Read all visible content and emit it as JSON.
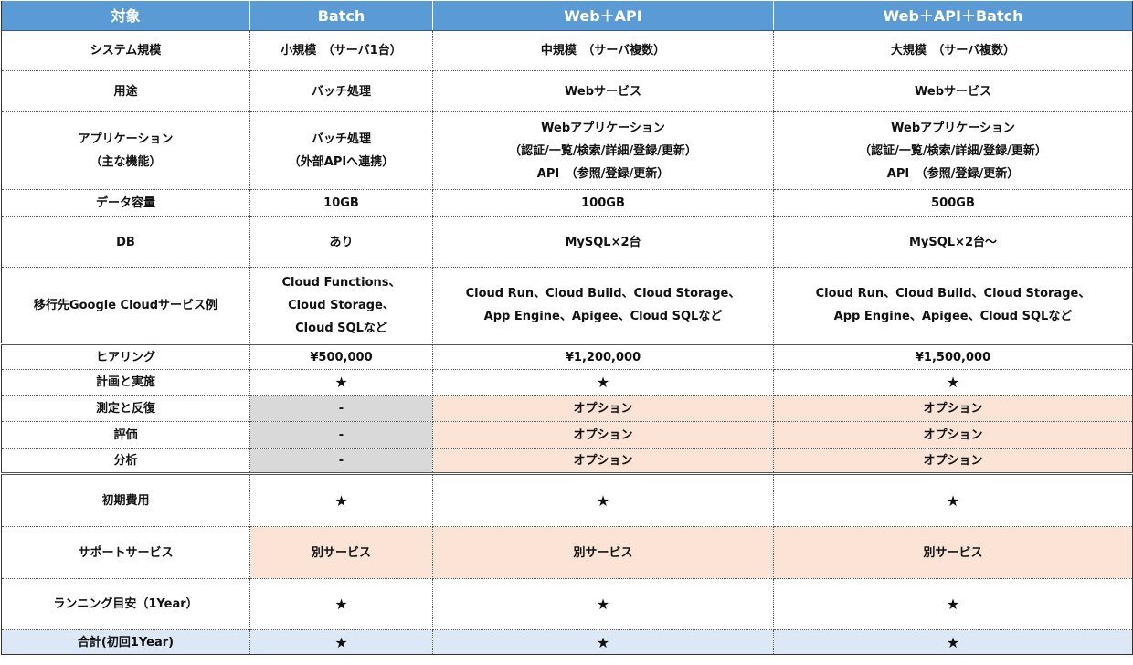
{
  "header": [
    "対象",
    "Batch",
    "Web＋API",
    "Web＋API＋Batch"
  ],
  "rows": {
    "system_scale": {
      "label": "システム規模",
      "batch": "小規模　（サーバ1台）",
      "web_api": "中規模　（サーバ複数）",
      "web_api_batch": "大規模　（サーバ複数）"
    },
    "usage": {
      "label": "用途",
      "batch": "バッチ処理",
      "web_api": "Webサービス",
      "web_api_batch": "Webサービス"
    },
    "application": {
      "label": [
        "アプリケーション",
        "（主な機能）"
      ],
      "batch": [
        "バッチ処理",
        "（外部APIへ連携）"
      ],
      "web_api": [
        "Webアプリケーション",
        "（認証/一覧/検索/詳細/登録/更新）",
        "API　（参照/登録/更新）"
      ],
      "web_api_batch": [
        "Webアプリケーション",
        "（認証/一覧/検索/詳細/登録/更新）",
        "API　（参照/登録/更新）"
      ]
    },
    "data_capacity": {
      "label": "データ容量",
      "batch": "10GB",
      "web_api": "100GB",
      "web_api_batch": "500GB"
    },
    "db": {
      "label": "DB",
      "batch": "あり",
      "web_api": "MySQL×2台",
      "web_api_batch": "MySQL×2台～"
    },
    "gcp_services": {
      "label": "移行先Google Cloudサービス例",
      "batch": [
        "Cloud Functions、",
        "Cloud Storage、",
        "Cloud SQLなど"
      ],
      "web_api": [
        "Cloud Run、Cloud Build、Cloud Storage、",
        "App Engine、Apigee、Cloud SQLなど"
      ],
      "web_api_batch": [
        "Cloud Run、Cloud Build、Cloud Storage、",
        "App Engine、Apigee、Cloud SQLなど"
      ]
    },
    "hearing": {
      "label": "ヒアリング",
      "batch": "¥500,000",
      "web_api": "¥1,200,000",
      "web_api_batch": "¥1,500,000"
    },
    "plan": {
      "label": "計画と実施",
      "batch": "★",
      "web_api": "★",
      "web_api_batch": "★"
    },
    "measure": {
      "label": "測定と反復",
      "batch": "-",
      "web_api": "オプション",
      "web_api_batch": "オプション"
    },
    "evaluate": {
      "label": "評価",
      "batch": "-",
      "web_api": "オプション",
      "web_api_batch": "オプション"
    },
    "analyze": {
      "label": "分析",
      "batch": "-",
      "web_api": "オプション",
      "web_api_batch": "オプション"
    },
    "initial_cost": {
      "label": "初期費用",
      "batch": "★",
      "web_api": "★",
      "web_api_batch": "★"
    },
    "support": {
      "label": "サポートサービス",
      "batch": "別サービス",
      "web_api": "別サービス",
      "web_api_batch": "別サービス"
    },
    "running": {
      "label": "ランニング目安（1Year）",
      "batch": "★",
      "web_api": "★",
      "web_api_batch": "★"
    },
    "total": {
      "label": "合計(初回1Year)",
      "batch": "★",
      "web_api": "★",
      "web_api_batch": "★"
    }
  },
  "colors": {
    "header_bg": "#5b9bd5",
    "option_bg": "#fbe4d6",
    "na_bg": "#d9d9d9",
    "total_bg": "#dde8f7"
  }
}
